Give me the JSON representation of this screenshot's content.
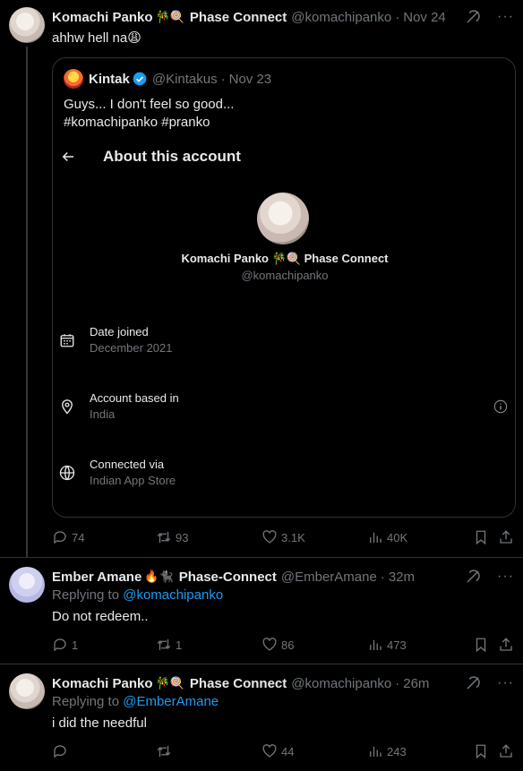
{
  "tweets": [
    {
      "name": "Komachi Panko",
      "emojis": "🎋🍭",
      "suffix": "Phase Connect",
      "handle": "@komachipanko",
      "time": "Nov 24",
      "text": "ahhw hell na😩",
      "stats": {
        "replies": "74",
        "retweets": "93",
        "likes": "3.1K",
        "views": "40K"
      }
    },
    {
      "name": "Ember Amane",
      "emojis": "🔥🐈‍⬛",
      "suffix": "Phase-Connect",
      "handle": "@EmberAmane",
      "time": "32m",
      "replying_prefix": "Replying to",
      "replying_to": "@komachipanko",
      "text": "Do not redeem..",
      "stats": {
        "replies": "1",
        "retweets": "1",
        "likes": "86",
        "views": "473"
      }
    },
    {
      "name": "Komachi Panko",
      "emojis": "🎋🍭",
      "suffix": "Phase Connect",
      "handle": "@komachipanko",
      "time": "26m",
      "replying_prefix": "Replying to",
      "replying_to": "@EmberAmane",
      "text": "i did the needful",
      "stats": {
        "replies": "",
        "retweets": "",
        "likes": "44",
        "views": "243"
      }
    }
  ],
  "quote": {
    "name": "Kintak",
    "handle": "@Kintakus",
    "time": "Nov 23",
    "text_line1": "Guys... I don't feel so good...",
    "text_line2": "#komachipanko #pranko",
    "about": {
      "title": "About this account",
      "display_name": "Komachi Panko 🎋🍭 Phase Connect",
      "handle": "@komachipanko",
      "rows": [
        {
          "label": "Date joined",
          "value": "December 2021",
          "icon": "calendar-icon"
        },
        {
          "label": "Account based in",
          "value": "India",
          "icon": "location-pin-icon"
        },
        {
          "label": "Connected via",
          "value": "Indian App Store",
          "icon": "globe-icon"
        }
      ]
    }
  },
  "separator": "·",
  "more_label": "···",
  "colors": {
    "background": "#000000",
    "text": "#e7e9ea",
    "muted": "#71767b",
    "link": "#1d9bf0",
    "border": "#2f3336"
  }
}
